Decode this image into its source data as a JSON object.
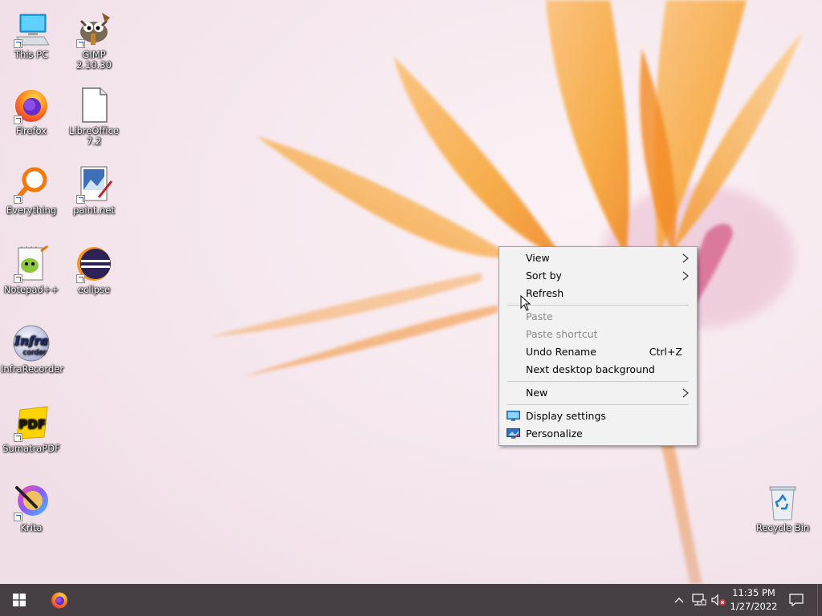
{
  "desktop": {
    "icons": [
      {
        "label": "This PC",
        "icon": "computer-icon"
      },
      {
        "label": "GIMP 2.10.30",
        "icon": "gimp-icon"
      },
      {
        "label": "Firefox",
        "icon": "firefox-icon"
      },
      {
        "label": "LibreOffice 7.2",
        "icon": "libreoffice-icon"
      },
      {
        "label": "Everything",
        "icon": "everything-search-icon"
      },
      {
        "label": "paint.net",
        "icon": "paintnet-icon"
      },
      {
        "label": "Notepad++",
        "icon": "notepadpp-icon"
      },
      {
        "label": "eclipse",
        "icon": "eclipse-icon"
      },
      {
        "label": "InfraRecorder",
        "icon": "infrarecorder-icon"
      },
      {
        "label": "SumatraPDF",
        "icon": "sumatrapdf-icon"
      },
      {
        "label": "Krita",
        "icon": "krita-icon"
      },
      {
        "label": "Recycle Bin",
        "icon": "recycle-bin-icon"
      }
    ],
    "infra_icon_text": [
      "Infra",
      "corder"
    ],
    "pdf_icon_text": "PDF"
  },
  "context_menu": {
    "items": [
      {
        "label": "View",
        "submenu": true
      },
      {
        "label": "Sort by",
        "submenu": true
      },
      {
        "label": "Refresh"
      },
      {
        "label": "Paste",
        "disabled": true
      },
      {
        "label": "Paste shortcut",
        "disabled": true
      },
      {
        "label": "Undo Rename",
        "shortcut": "Ctrl+Z"
      },
      {
        "label": "Next desktop background"
      },
      {
        "label": "New",
        "submenu": true
      },
      {
        "label": "Display settings",
        "icon": "display-settings-icon"
      },
      {
        "label": "Personalize",
        "icon": "personalize-icon"
      }
    ]
  },
  "taskbar": {
    "clock_time": "11:35 PM",
    "clock_date": "1/27/2022",
    "pinned": [
      "start-button",
      "firefox-taskbar-icon"
    ],
    "tray_icons": [
      "chevron-up-icon",
      "network-icon",
      "volume-muted-icon",
      "action-center-icon"
    ]
  },
  "colors": {
    "taskbar": "#463f43",
    "menu_bg": "#f2f2f2",
    "flower": "#f7a934"
  }
}
